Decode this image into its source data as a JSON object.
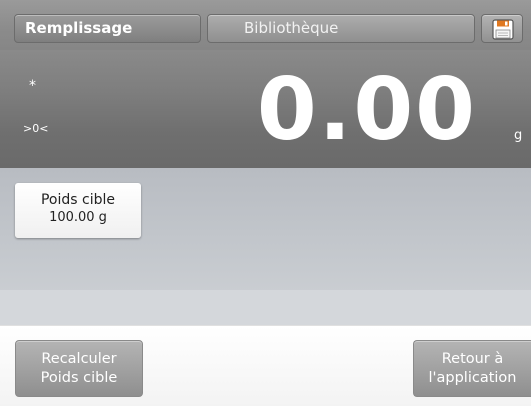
{
  "tabs": {
    "active_label": "Remplissage",
    "library_label": "Bibliothèque"
  },
  "icons": {
    "save": "save-icon"
  },
  "display": {
    "stable_indicator": "*",
    "zero_indicator": ">0<",
    "weight": "0.00",
    "unit": "g"
  },
  "target": {
    "label": "Poids cible",
    "value": "100.00 g"
  },
  "actions": {
    "recalculate_line1": "Recalculer",
    "recalculate_line2": "Poids cible",
    "return_line1": "Retour à",
    "return_line2": "l'application"
  },
  "colors": {
    "display_bg": "#7e7e7e",
    "tab_bg": "#8f8f8f",
    "save_icon_accent": "#e07820"
  }
}
